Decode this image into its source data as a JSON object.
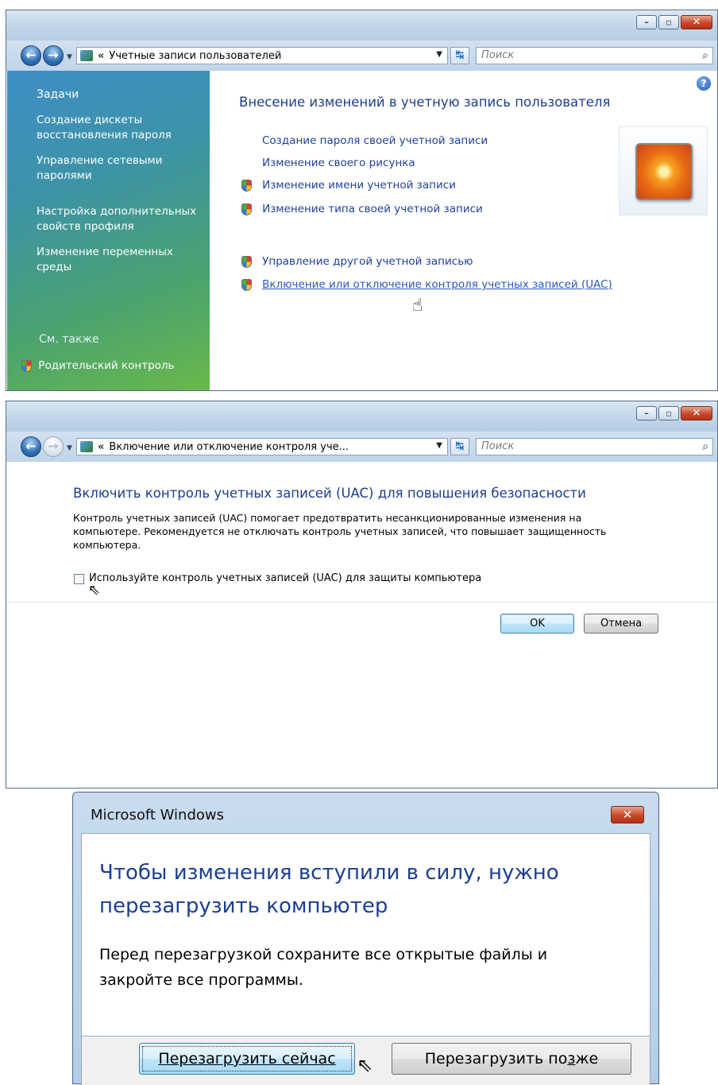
{
  "window1": {
    "address": "Учетные записи пользователей",
    "search_placeholder": "Поиск",
    "sidebar": {
      "tasks_heading": "Задачи",
      "tasks": [
        {
          "label": "Создание дискеты восстановления пароля"
        },
        {
          "label": "Управление сетевыми паролями"
        },
        {
          "label": "Настройка дополнительных свойств профиля"
        },
        {
          "label": "Изменение переменных среды"
        }
      ],
      "see_also_heading": "См. также",
      "see_also": [
        {
          "label": "Родительский контроль"
        }
      ]
    },
    "heading": "Внесение изменений в учетную запись пользователя",
    "links": [
      {
        "label": "Создание пароля своей учетной записи",
        "shield": false
      },
      {
        "label": "Изменение своего рисунка",
        "shield": false
      },
      {
        "label": "Изменение имени учетной записи",
        "shield": true
      },
      {
        "label": "Изменение типа своей учетной записи",
        "shield": true
      }
    ],
    "links2": [
      {
        "label": "Управление другой учетной записью",
        "shield": true
      },
      {
        "label": "Включение или отключение контроля учетных записей (UAC)",
        "shield": true,
        "hovered": true
      }
    ]
  },
  "window2": {
    "address": "Включение или отключение контроля уче...",
    "search_placeholder": "Поиск",
    "heading": "Включить контроль учетных записей (UAC) для повышения безопасности",
    "description": "Контроль учетных записей (UAC) помогает предотвратить несанкционированные изменения на компьютере.  Рекомендуется не отключать контроль учетных записей, что повышает защищенность компьютера.",
    "checkbox_label": "Используйте контроль учетных записей (UAC) для защиты компьютера",
    "checkbox_checked": false,
    "ok_label": "OK",
    "cancel_label": "Отмена"
  },
  "dialog": {
    "title": "Microsoft Windows",
    "main_instruction": "Чтобы изменения вступили в силу, нужно перезагрузить компьютер",
    "content": "Перед перезагрузкой сохраните все открытые файлы и закройте все программы.",
    "restart_now_label": "Перезагрузить сейчас",
    "restart_later_pre": "Перезагрузить по",
    "restart_later_accel": "з",
    "restart_later_post": "же"
  },
  "colors": {
    "link": "#1e3f9e",
    "heading": "#1e3d8f",
    "sidebar_top": "#3f8ec7",
    "sidebar_bottom": "#6ab84b"
  }
}
